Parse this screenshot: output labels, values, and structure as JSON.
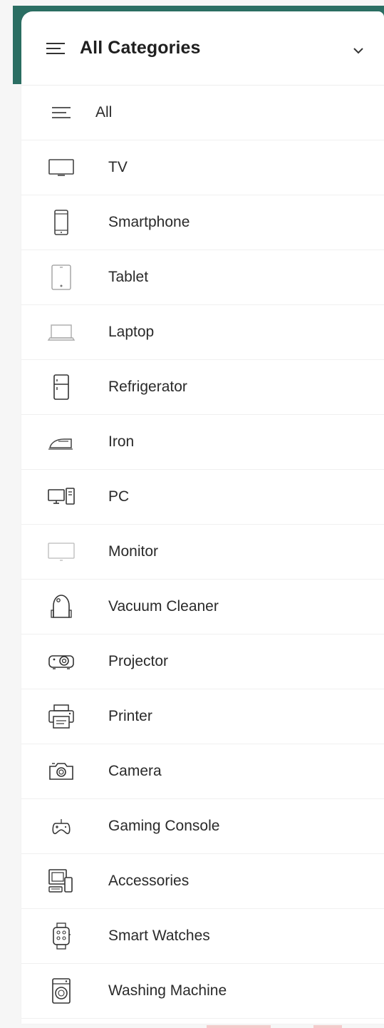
{
  "header": {
    "title": "All Categories",
    "icon": "hamburger-icon",
    "toggle_icon": "chevron-down-icon"
  },
  "categories": [
    {
      "label": "All",
      "icon": "hamburger-icon"
    },
    {
      "label": "TV",
      "icon": "tv-icon"
    },
    {
      "label": "Smartphone",
      "icon": "smartphone-icon"
    },
    {
      "label": "Tablet",
      "icon": "tablet-icon"
    },
    {
      "label": "Laptop",
      "icon": "laptop-icon"
    },
    {
      "label": "Refrigerator",
      "icon": "refrigerator-icon"
    },
    {
      "label": "Iron",
      "icon": "iron-icon"
    },
    {
      "label": "PC",
      "icon": "pc-icon"
    },
    {
      "label": "Monitor",
      "icon": "monitor-icon"
    },
    {
      "label": "Vacuum Cleaner",
      "icon": "vacuum-cleaner-icon"
    },
    {
      "label": "Projector",
      "icon": "projector-icon"
    },
    {
      "label": "Printer",
      "icon": "printer-icon"
    },
    {
      "label": "Camera",
      "icon": "camera-icon"
    },
    {
      "label": "Gaming Console",
      "icon": "gamepad-icon"
    },
    {
      "label": "Accessories",
      "icon": "accessories-icon"
    },
    {
      "label": "Smart Watches",
      "icon": "smartwatch-icon"
    },
    {
      "label": "Washing Machine",
      "icon": "washing-machine-icon"
    }
  ],
  "colors": {
    "accent": "#2b6e63",
    "text": "#2a2a2a",
    "icon_stroke": "#333333"
  }
}
